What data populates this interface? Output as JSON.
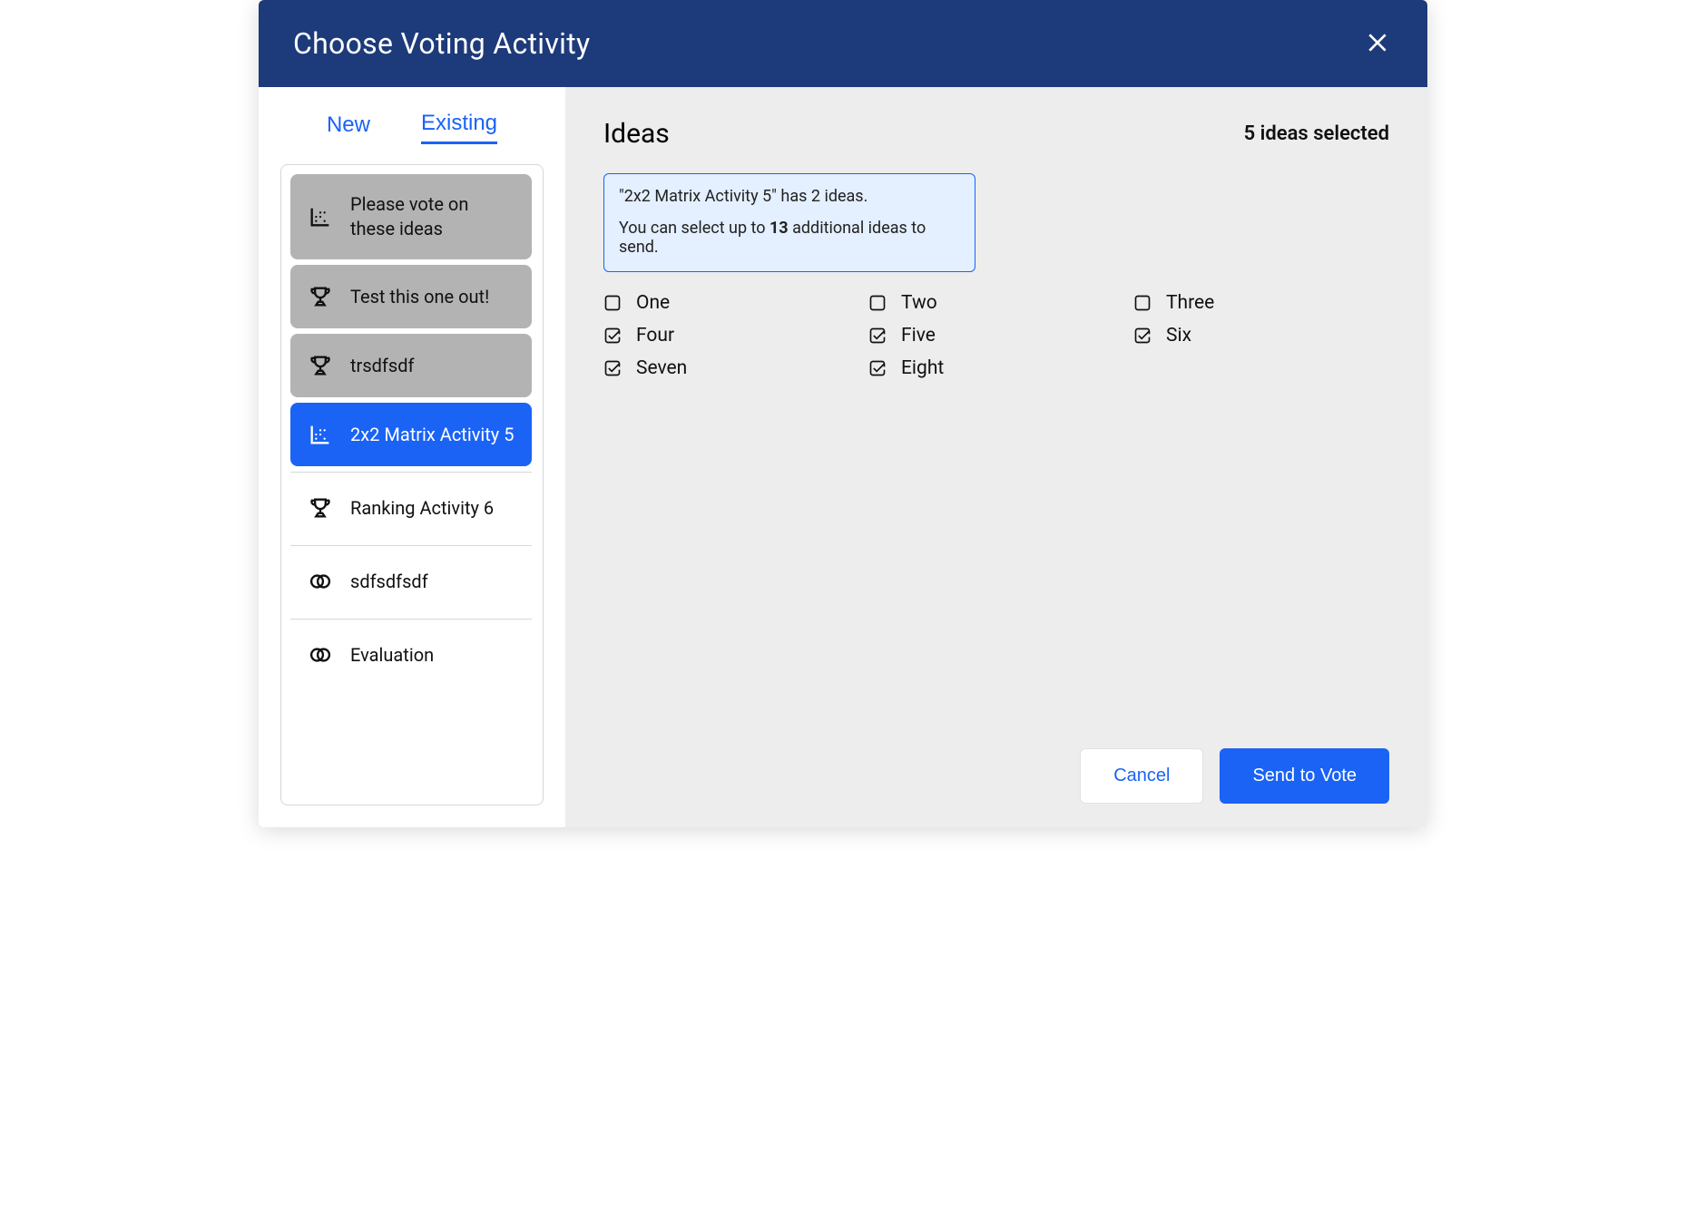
{
  "header": {
    "title": "Choose Voting Activity"
  },
  "sidebar": {
    "tabs": {
      "new": "New",
      "existing": "Existing",
      "active": "existing"
    },
    "activities": [
      {
        "label": "Please vote on these ideas",
        "icon": "matrix",
        "state": "disabled"
      },
      {
        "label": "Test this one out!",
        "icon": "trophy",
        "state": "disabled"
      },
      {
        "label": "trsdfsdf",
        "icon": "trophy",
        "state": "disabled"
      },
      {
        "label": "2x2 Matrix Activity 5",
        "icon": "matrix",
        "state": "selected"
      },
      {
        "label": "Ranking Activity 6",
        "icon": "trophy",
        "state": "normal"
      },
      {
        "label": "sdfsdfsdf",
        "icon": "rings",
        "state": "normal"
      },
      {
        "label": "Evaluation",
        "icon": "rings",
        "state": "normal"
      }
    ]
  },
  "main": {
    "heading": "Ideas",
    "selected_count_text": "5 ideas selected",
    "info": {
      "line1": "\"2x2 Matrix Activity 5\" has 2 ideas.",
      "line2_prefix": "You can select up to ",
      "line2_bold": "13",
      "line2_suffix": " additional ideas to send."
    },
    "ideas": [
      {
        "label": "One",
        "checked": false
      },
      {
        "label": "Two",
        "checked": false
      },
      {
        "label": "Three",
        "checked": false
      },
      {
        "label": "Four",
        "checked": true
      },
      {
        "label": "Five",
        "checked": true
      },
      {
        "label": "Six",
        "checked": true
      },
      {
        "label": "Seven",
        "checked": true
      },
      {
        "label": "Eight",
        "checked": true
      }
    ]
  },
  "footer": {
    "cancel": "Cancel",
    "submit": "Send to Vote"
  }
}
